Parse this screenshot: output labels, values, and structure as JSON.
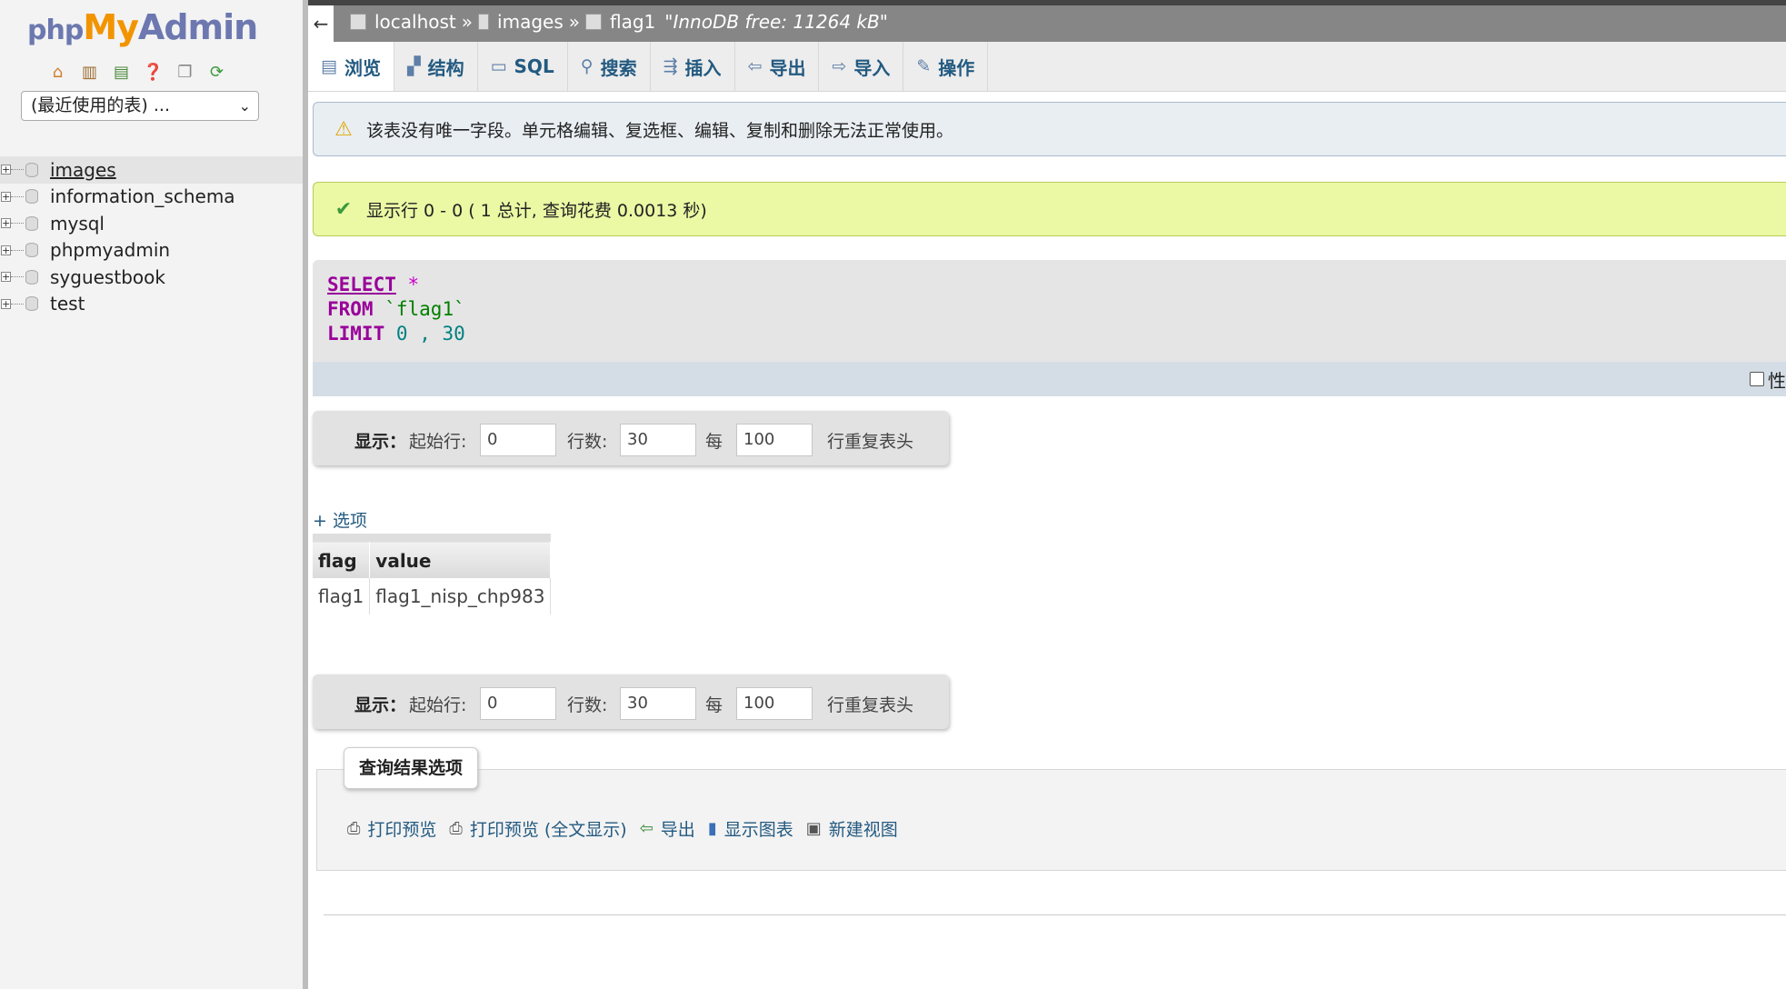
{
  "sidebar": {
    "logo": {
      "php": "php",
      "my": "My",
      "admin": "Admin"
    },
    "nav_icons": [
      "home-icon",
      "docs-icon",
      "sql-icon",
      "help-icon",
      "copy-icon",
      "reload-icon"
    ],
    "recent_tables": "(最近使用的表) ...",
    "databases": [
      {
        "label": "images",
        "active": true
      },
      {
        "label": "information_schema",
        "active": false
      },
      {
        "label": "mysql",
        "active": false
      },
      {
        "label": "phpmyadmin",
        "active": false
      },
      {
        "label": "syguestbook",
        "active": false
      },
      {
        "label": "test",
        "active": false
      }
    ]
  },
  "topbar": {
    "back": "←",
    "server": "localhost",
    "sep": "»",
    "database": "images",
    "table": "flag1",
    "note": "\"InnoDB free: 11264 kB\""
  },
  "tabs": [
    {
      "label": "浏览",
      "icon": "browse-icon"
    },
    {
      "label": "结构",
      "icon": "structure-icon"
    },
    {
      "label": "SQL",
      "icon": "sql-icon"
    },
    {
      "label": "搜索",
      "icon": "search-icon"
    },
    {
      "label": "插入",
      "icon": "insert-icon"
    },
    {
      "label": "导出",
      "icon": "export-icon"
    },
    {
      "label": "导入",
      "icon": "import-icon"
    },
    {
      "label": "操作",
      "icon": "operations-icon"
    }
  ],
  "messages": {
    "warning": "该表没有唯一字段。单元格编辑、复选框、编辑、复制和删除无法正常使用。",
    "success": "显示行 0 - 0 ( 1 总计, 查询花费 0.0013 秒)"
  },
  "sql": {
    "select": "SELECT",
    "star": "*",
    "from": "FROM",
    "table": "`flag1`",
    "limit": "LIMIT",
    "offset": "0",
    "comma": ",",
    "count": "30",
    "profiling_label": "性"
  },
  "navigation": {
    "show": "显示：",
    "start_label": "起始行:",
    "start_value": "0",
    "rows_label": "行数:",
    "rows_value": "30",
    "per_label": "每",
    "per_value": "100",
    "repeat_label": "行重复表头"
  },
  "options_link": "+ 选项",
  "results": {
    "columns": [
      "flag",
      "value"
    ],
    "rows": [
      [
        "flag1",
        "flag1_nisp_chp983"
      ]
    ]
  },
  "query_ops": {
    "legend": "查询结果选项",
    "links": [
      {
        "label": "打印预览",
        "icon": "print-icon"
      },
      {
        "label": "打印预览 (全文显示)",
        "icon": "print-icon"
      },
      {
        "label": "导出",
        "icon": "export-icon"
      },
      {
        "label": "显示图表",
        "icon": "chart-icon"
      },
      {
        "label": "新建视图",
        "icon": "view-icon"
      }
    ]
  }
}
